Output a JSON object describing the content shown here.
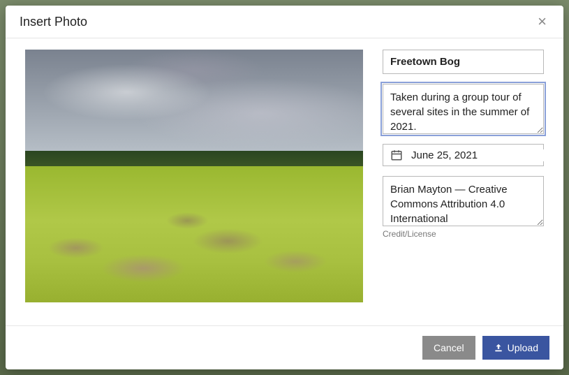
{
  "modal": {
    "title": "Insert Photo",
    "close_label": "×"
  },
  "form": {
    "title_value": "Freetown Bog",
    "description_value": "Taken during a group tour of several sites in the summer of 2021.",
    "date_value": "June 25, 2021",
    "credit_value": "Brian Mayton — Creative Commons Attribution 4.0 International",
    "credit_helper": "Credit/License"
  },
  "footer": {
    "cancel_label": "Cancel",
    "upload_label": "Upload"
  }
}
